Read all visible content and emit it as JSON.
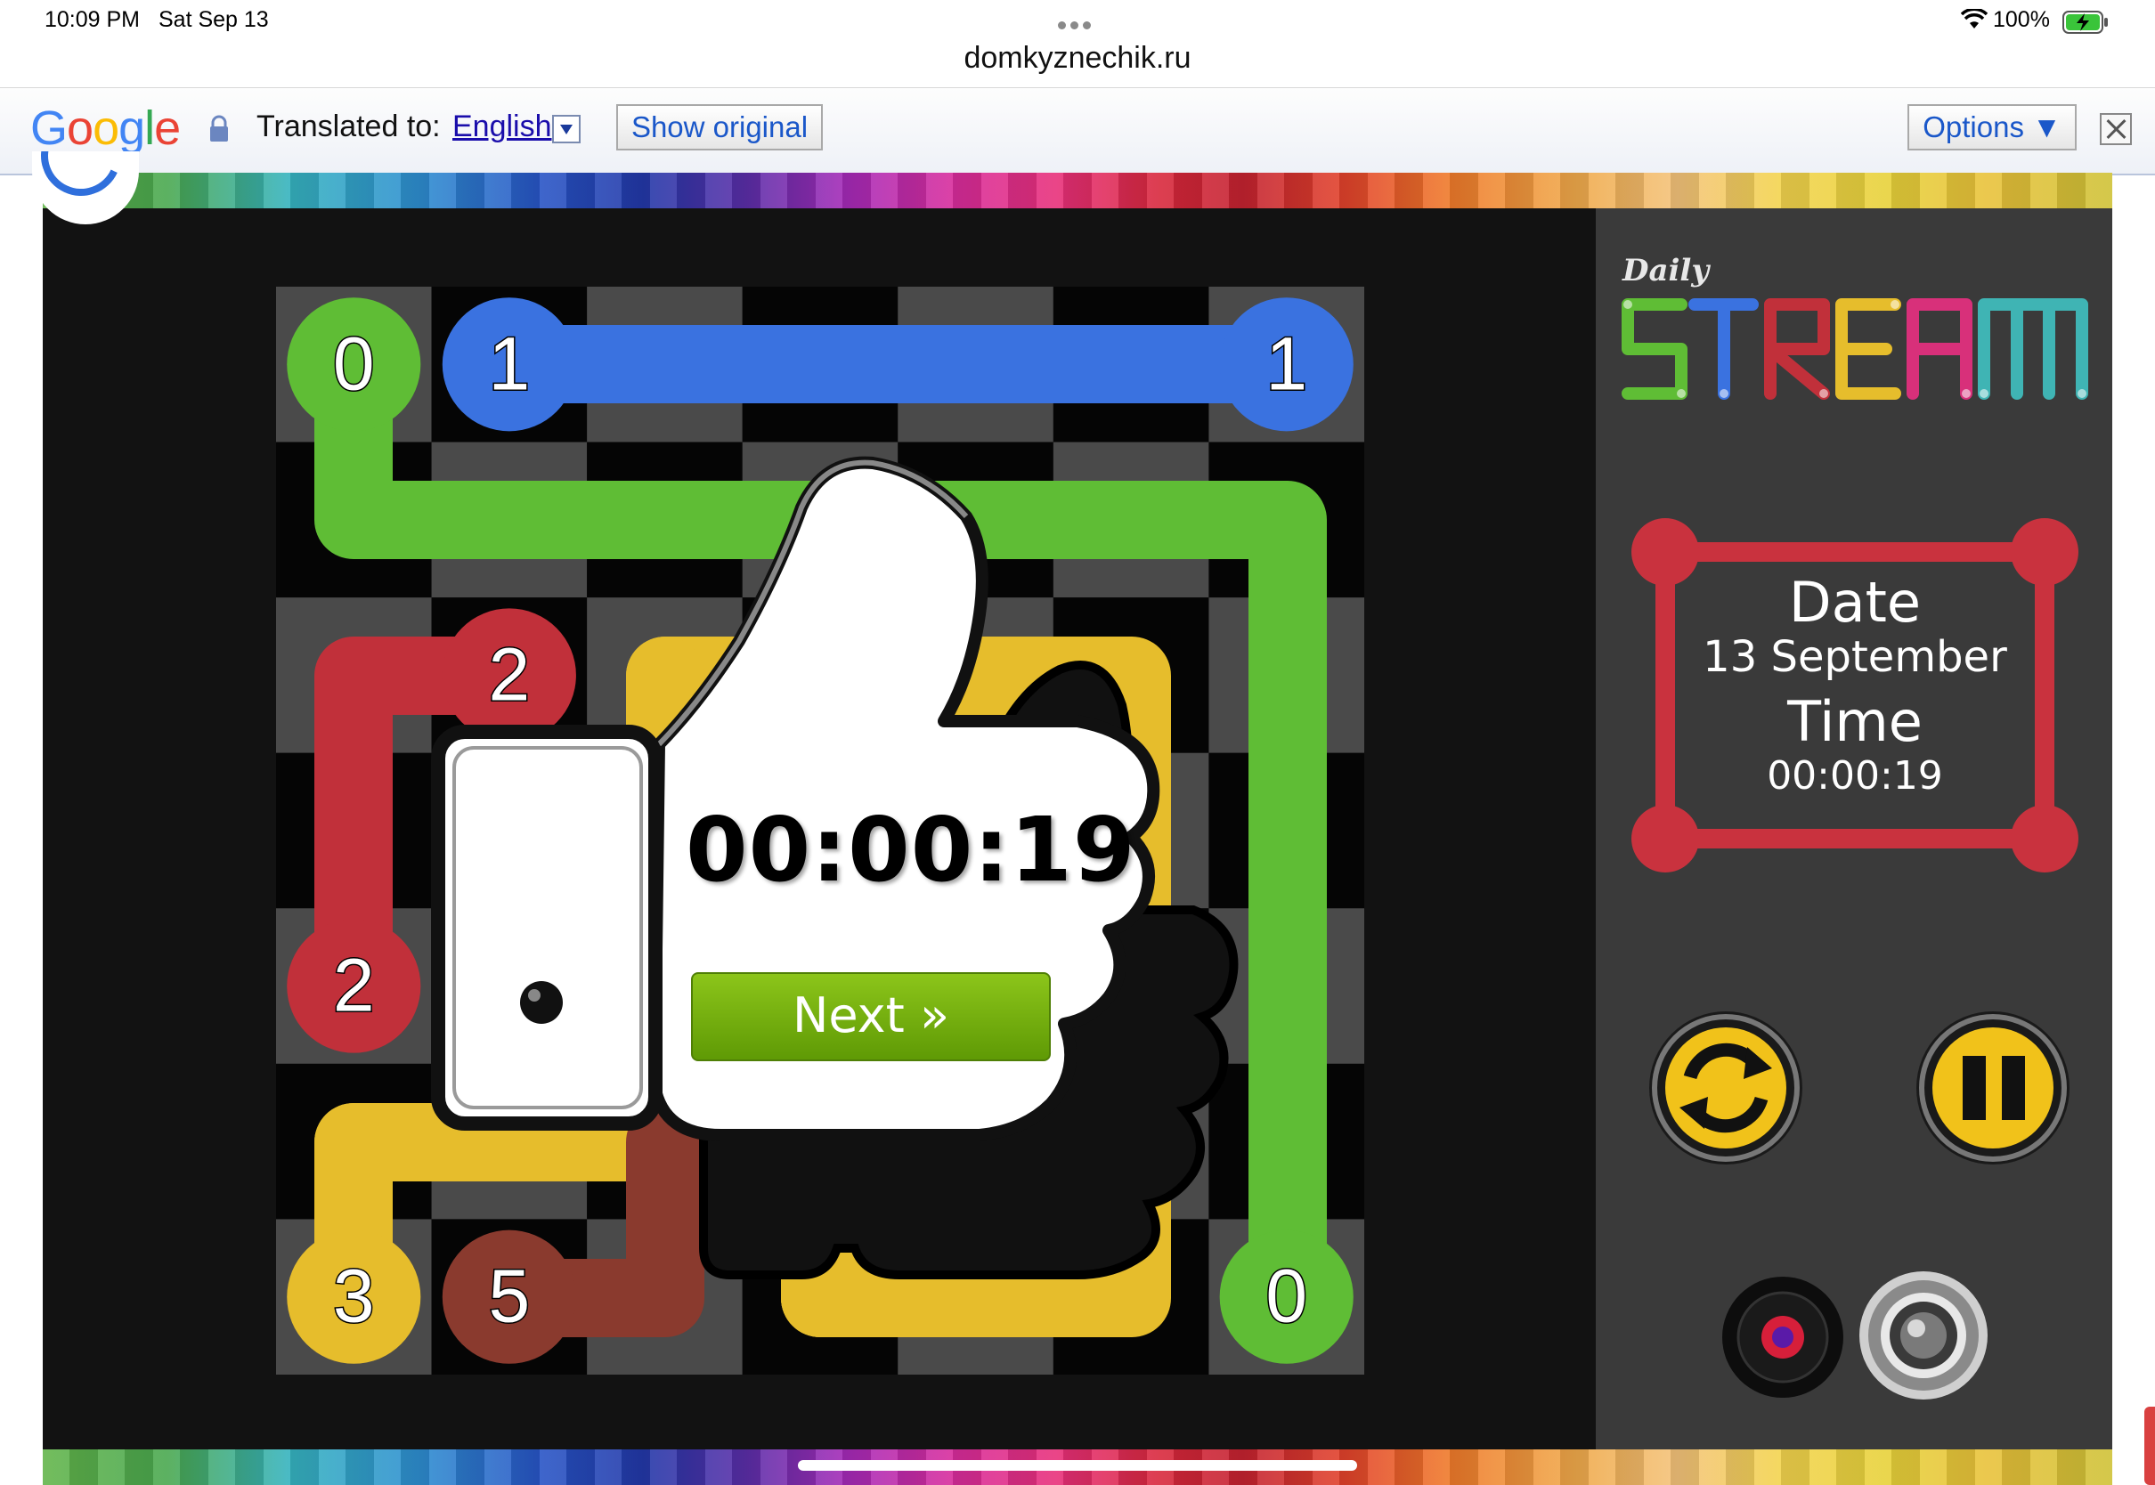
{
  "status_bar": {
    "time": "10:09 PM",
    "date": "Sat Sep 13",
    "battery": "100%"
  },
  "browser": {
    "url": "domkyznechik.ru"
  },
  "translate_bar": {
    "logo": "Google",
    "translated_to_label": "Translated to:",
    "language": "English",
    "show_original": "Show original",
    "options": "Options ▼"
  },
  "game": {
    "title_small": "Daily",
    "title": "STREAM",
    "board": {
      "size": 7,
      "nodes": [
        {
          "label": "0",
          "color": "#5fbd35",
          "row": 0,
          "col": 0
        },
        {
          "label": "1",
          "color": "#3a72e0",
          "row": 0,
          "col": 1
        },
        {
          "label": "1",
          "color": "#3a72e0",
          "row": 0,
          "col": 6
        },
        {
          "label": "2",
          "color": "#c1303a",
          "row": 2,
          "col": 1
        },
        {
          "label": "2",
          "color": "#c1303a",
          "row": 4,
          "col": 0
        },
        {
          "label": "3",
          "color": "#e6bd2c",
          "row": 6,
          "col": 0
        },
        {
          "label": "5",
          "color": "#8a3a2e",
          "row": 6,
          "col": 1
        },
        {
          "label": "0",
          "color": "#5fbd35",
          "row": 6,
          "col": 6
        }
      ]
    },
    "result": {
      "time": "00:00:19",
      "next_button": "Next »"
    },
    "info": {
      "date_label": "Date",
      "date": "13 September",
      "time_label": "Time",
      "time": "00:00:19"
    },
    "controls": {
      "restart_icon": "restart-icon",
      "pause_icon": "pause-icon",
      "record_icon": "record-icon",
      "speaker_icon": "speaker-icon"
    },
    "colors": {
      "green": "#5fbd35",
      "blue": "#3a72e0",
      "red": "#c1303a",
      "yellow": "#e6bd2c",
      "brown": "#8a3a2e",
      "teal": "#5bb6bf",
      "frame_red": "#c9323e"
    }
  }
}
